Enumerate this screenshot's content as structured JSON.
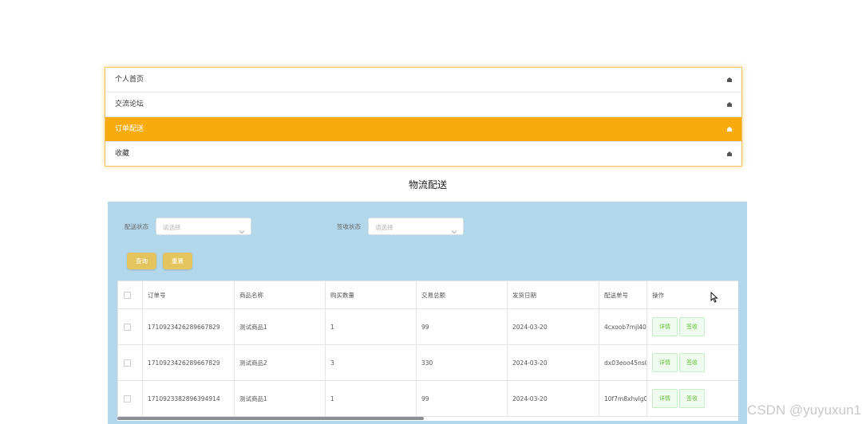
{
  "menu": {
    "items": [
      {
        "label": "个人首页",
        "icon": "home-icon",
        "active": false
      },
      {
        "label": "交流论坛",
        "icon": "home-icon",
        "active": false
      },
      {
        "label": "订单配送",
        "icon": "home-icon",
        "active": true
      },
      {
        "label": "收藏",
        "icon": "home-icon",
        "active": false
      }
    ],
    "active_color": "#f8ab0c"
  },
  "page_title": "物流配送",
  "filters": {
    "delivery_status": {
      "label": "配送状态",
      "placeholder": "请选择"
    },
    "receipt_status": {
      "label": "签收状态",
      "placeholder": "请选择"
    }
  },
  "actions": {
    "query_label": "查询",
    "reset_label": "重置"
  },
  "table": {
    "headers": [
      "订单号",
      "商品名称",
      "购买数量",
      "交易总额",
      "发货日期",
      "配送单号",
      "操作"
    ],
    "rows": [
      {
        "order_no": "1710923426289667829",
        "product": "测试商品1",
        "qty": "1",
        "total": "99",
        "ship_date": "2024-03-20",
        "tracking": "4cxoob7mjl400",
        "detail_label": "详情",
        "sign_label": "签收"
      },
      {
        "order_no": "1710923426289667829",
        "product": "测试商品2",
        "qty": "3",
        "total": "330",
        "ship_date": "2024-03-20",
        "tracking": "dx03eoo45ns0",
        "detail_label": "详情",
        "sign_label": "签收"
      },
      {
        "order_no": "1710923382896394914",
        "product": "测试商品1",
        "qty": "1",
        "total": "99",
        "ship_date": "2024-03-20",
        "tracking": "10f7m8xhvlg00",
        "detail_label": "详情",
        "sign_label": "签收"
      }
    ]
  },
  "watermark": "CSDN @yuyuxun1",
  "colors": {
    "panel_bg": "#b2d6ea",
    "button_bg": "#e4c45c",
    "op_button_text": "#67c23a"
  }
}
